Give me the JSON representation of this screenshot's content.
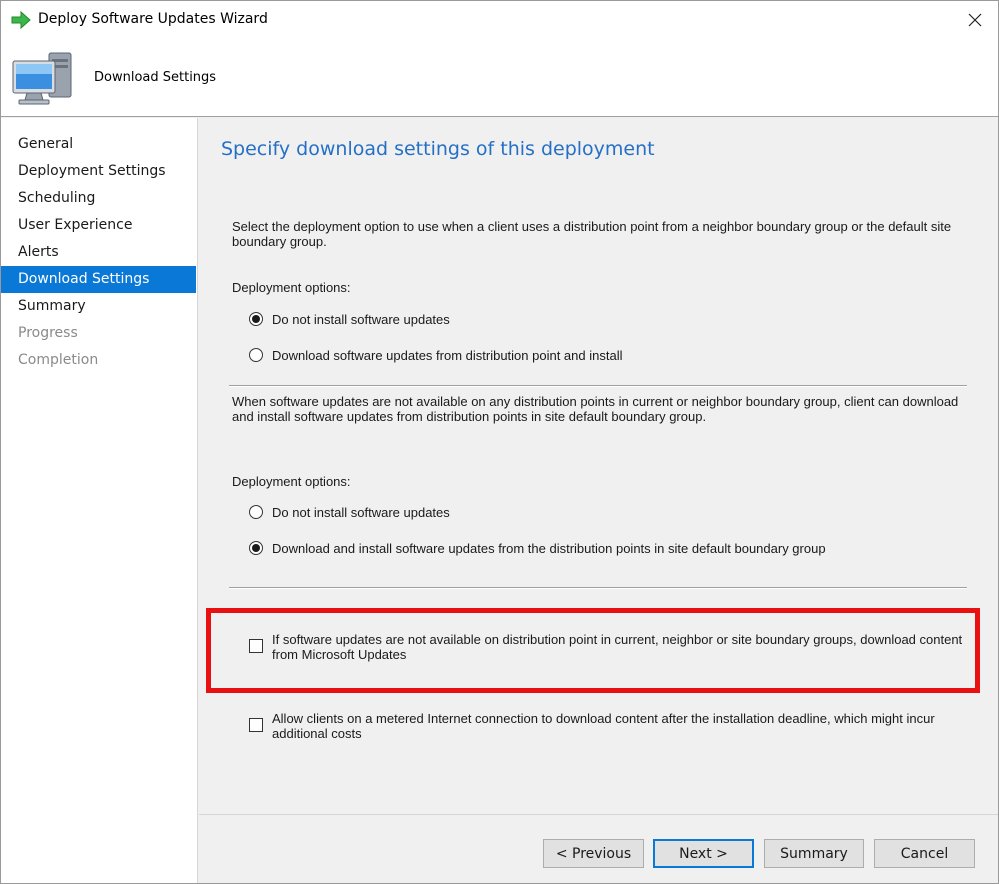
{
  "window": {
    "title": "Deploy Software Updates Wizard",
    "close_label": "Close"
  },
  "header": {
    "title": "Download Settings"
  },
  "nav": {
    "items": [
      {
        "label": "General",
        "state": "normal"
      },
      {
        "label": "Deployment Settings",
        "state": "normal"
      },
      {
        "label": "Scheduling",
        "state": "normal"
      },
      {
        "label": "User Experience",
        "state": "normal"
      },
      {
        "label": "Alerts",
        "state": "normal"
      },
      {
        "label": "Download Settings",
        "state": "active"
      },
      {
        "label": "Summary",
        "state": "normal"
      },
      {
        "label": "Progress",
        "state": "disabled"
      },
      {
        "label": "Completion",
        "state": "disabled"
      }
    ]
  },
  "content": {
    "page_title": "Specify download settings of this deployment",
    "section1": {
      "description": "Select the deployment option to use when a client uses a distribution point from a neighbor boundary group or the default site boundary group.",
      "options_label": "Deployment options:",
      "options": [
        {
          "label": "Do not install software updates",
          "checked": true
        },
        {
          "label": "Download software updates from distribution point and install",
          "checked": false
        }
      ]
    },
    "section2": {
      "description": "When software updates are not available on any distribution points in current or neighbor boundary group, client can download and install software updates from distribution points in site default boundary group.",
      "options_label": "Deployment options:",
      "options": [
        {
          "label": "Do not install software updates",
          "checked": false
        },
        {
          "label": "Download and install software updates from the distribution points in site default boundary group",
          "checked": true
        }
      ]
    },
    "checkboxes": [
      {
        "label": "If software updates are not available on distribution point in current, neighbor or site boundary groups, download content from Microsoft Updates",
        "checked": false
      },
      {
        "label": "Allow clients on a metered Internet connection to download content after the installation deadline, which might incur additional costs",
        "checked": false
      }
    ]
  },
  "buttons": {
    "previous": "< Previous",
    "next": "Next >",
    "summary": "Summary",
    "cancel": "Cancel"
  },
  "colors": {
    "accent": "#0a78d7",
    "title_blue": "#2570c6",
    "highlight_red": "#e81010"
  }
}
